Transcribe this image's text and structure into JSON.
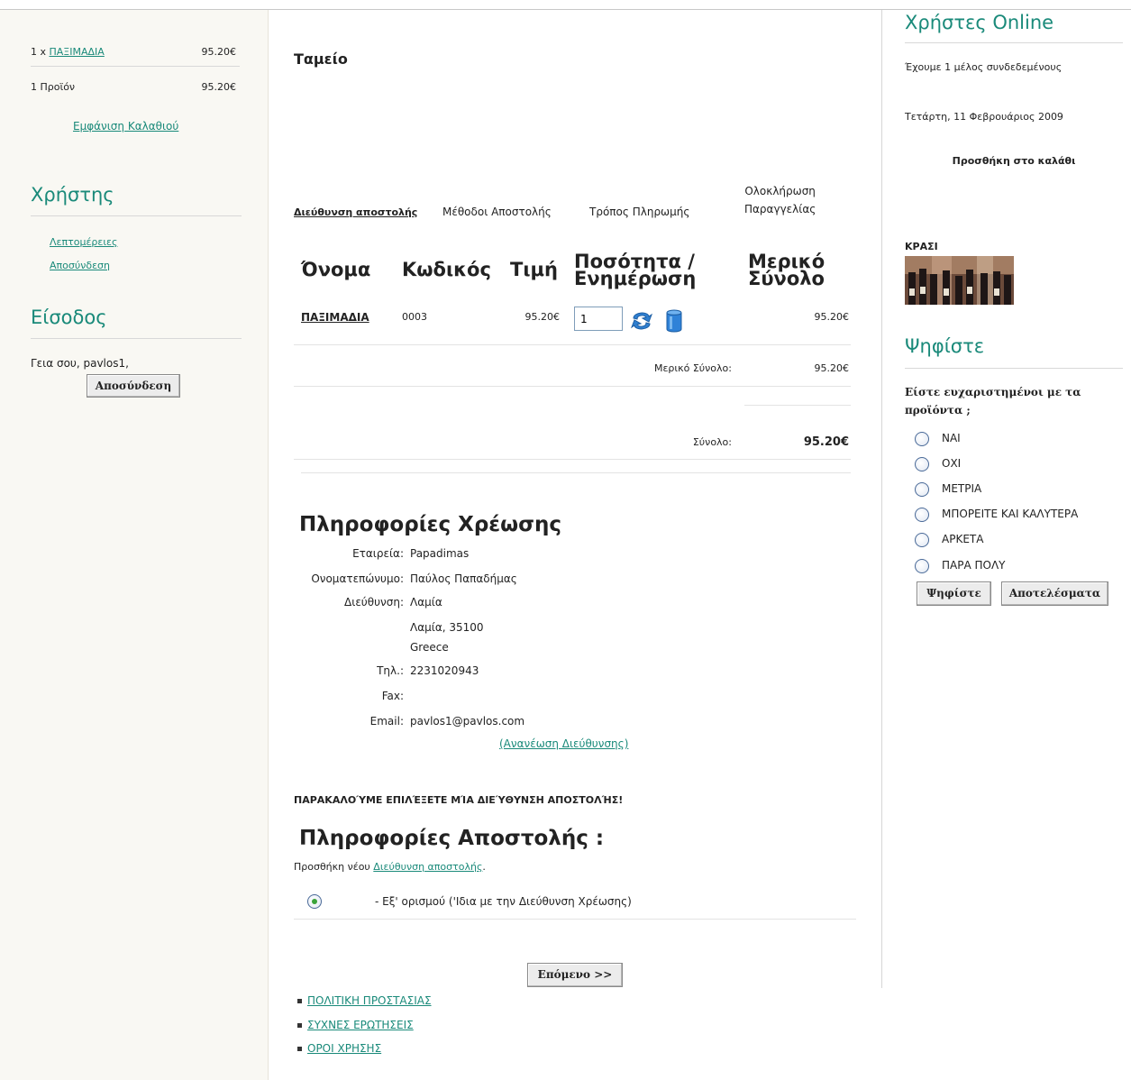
{
  "cart": {
    "item_qty_prefix": "1 x",
    "item_name": "ΠΑΞΙΜΑΔΙΑ",
    "item_price": "95.20€",
    "summary_label": "1 Προϊόν",
    "summary_price": "95.20€",
    "view_cart": "Εμφάνιση Καλαθιού"
  },
  "user_section": {
    "title": "Χρήστης",
    "details": "Λεπτομέρειες",
    "logout": "Αποσύνδεση"
  },
  "login_section": {
    "title": "Είσοδος",
    "greeting": "Γεια σου, pavlos1,",
    "logout_button": "Αποσύνδεση"
  },
  "page": {
    "title": "Ταμείο"
  },
  "steps": {
    "shipping_address": "Διεύθυνση αποστολής",
    "shipping_method": "Μέθοδοι Αποστολής",
    "payment": "Τρόπος Πληρωμής",
    "complete_line1": "Ολοκλήρωση",
    "complete_line2": "Παραγγελίας"
  },
  "table": {
    "headers": {
      "name": "Όνομα",
      "code": "Κωδικός",
      "price": "Τιμή",
      "qty_line1": "Ποσότητα /",
      "qty_line2": "Ενημέρωση",
      "subtotal_line1": "Μερικό",
      "subtotal_line2": "Σύνολο"
    },
    "row": {
      "name": "ΠΑΞΙΜΑΔΙΑ",
      "code": "0003",
      "price": "95.20€",
      "qty": "1",
      "subtotal": "95.20€"
    },
    "subtotal_label": "Μερικό Σύνολο:",
    "subtotal_value": "95.20€",
    "total_label": "Σύνολο:",
    "total_value": "95.20€"
  },
  "billing": {
    "title": "Πληροφορίες Χρέωσης",
    "company_label": "Εταιρεία:",
    "company": "Papadimas",
    "name_label": "Ονοματεπώνυμο:",
    "name": "Παύλος Παπαδήμας",
    "address_label": "Διεύθυνση:",
    "address1": "Λαμία",
    "address2": "Λαμία, 35100",
    "country": "Greece",
    "phone_label": "Τηλ.:",
    "phone": "2231020943",
    "fax_label": "Fax:",
    "fax": "",
    "email_label": "Email:",
    "email": "pavlos1@pavlos.com",
    "update_link": "(Ανανέωση Διεύθυνσης)"
  },
  "shipping": {
    "notice": "ΠΑΡΑΚΑΛΟΎΜΕ ΕΠΙΛΈΞΕΤΕ ΜΊΑ ΔΙΕΎΘΥΝΣΗ ΑΠΟΣΤΟΛΉΣ!",
    "title": "Πληροφορίες Αποστολής :",
    "add_prefix": "Προσθήκη νέου",
    "add_link": "Διεύθυνση αποστολής",
    "add_suffix": ".",
    "default_option": "- Εξ' ορισμού ('Ιδια με την Διεύθυνση Χρέωσης)"
  },
  "next_button": "Επόμενο >>",
  "footer_links": [
    "ΠΟΛΙΤΙΚΗ ΠΡΟΣΤΑΣΙΑΣ",
    "ΣΥΧΝΕΣ ΕΡΩΤΗΣΕΙΣ",
    "ΟΡΟΙ ΧΡΗΣΗΣ"
  ],
  "right": {
    "online_title": "Χρήστες Online",
    "online_text": "Έχουμε 1 μέλος συνδεδεμένους",
    "date": "Τετάρτη, 11 Φεβρουάριος 2009",
    "add_to_cart": "Προσθήκη στο καλάθι",
    "product_label": "ΚΡΑΣΙ",
    "poll_title": "Ψηφίστε",
    "poll_question_line1": "Είστε ευχαριστημένοι με τα",
    "poll_question_line2": "προϊόντα ;",
    "poll_options": [
      "ΝΑΙ",
      "ΟΧΙ",
      "ΜΕΤΡΙΑ",
      "ΜΠΟΡΕΙΤΕ ΚΑΙ ΚΑΛΥΤΕΡΑ",
      "ΑΡΚΕΤΑ",
      "ΠΑΡΑ ΠΟΛΥ"
    ],
    "vote_button": "Ψηφίστε",
    "results_button": "Αποτελέσματα"
  },
  "colors": {
    "accent": "#1a8a7a",
    "left_bg": "#f9f8f3"
  }
}
